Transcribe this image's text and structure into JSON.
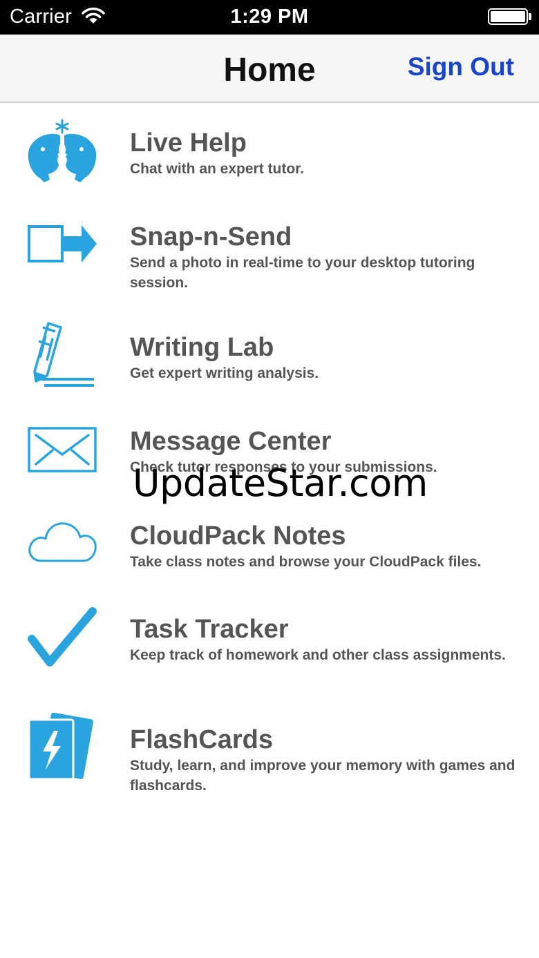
{
  "status_bar": {
    "carrier": "Carrier",
    "time": "1:29 PM"
  },
  "nav": {
    "title": "Home",
    "sign_out": "Sign Out"
  },
  "menu": [
    {
      "title": "Live Help",
      "description": "Chat with an expert tutor.",
      "icon": "live-help-icon"
    },
    {
      "title": "Snap-n-Send",
      "description": "Send a photo in real-time to your desktop tutoring session.",
      "icon": "snap-send-icon"
    },
    {
      "title": "Writing Lab",
      "description": "Get expert writing analysis.",
      "icon": "pencil-icon"
    },
    {
      "title": "Message Center",
      "description": "Check tutor responses to your submissions.",
      "icon": "envelope-icon"
    },
    {
      "title": "CloudPack Notes",
      "description": "Take class notes and browse your CloudPack files.",
      "icon": "cloud-icon"
    },
    {
      "title": "Task Tracker",
      "description": "Keep track of homework and other class assignments.",
      "icon": "checkmark-icon"
    },
    {
      "title": "FlashCards",
      "description": "Study, learn, and improve your memory with games and flashcards.",
      "icon": "flashcards-icon"
    }
  ],
  "watermark": "UpdateStar.com",
  "colors": {
    "icon_blue": "#2aa4de",
    "link_blue": "#1b45c9",
    "text_gray": "#555555"
  }
}
